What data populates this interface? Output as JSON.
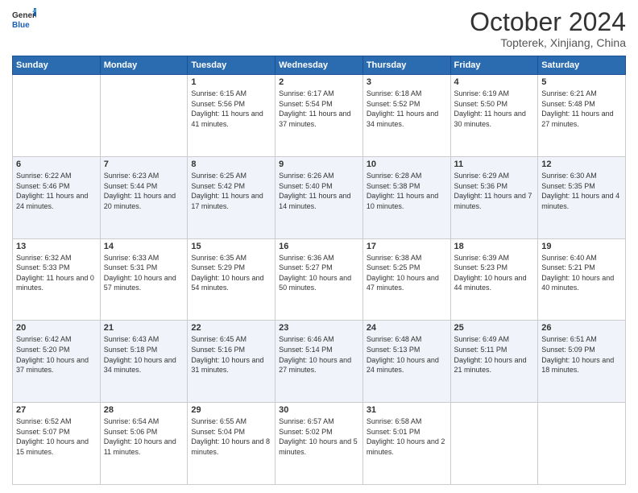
{
  "header": {
    "logo_line1": "General",
    "logo_line2": "Blue",
    "month_title": "October 2024",
    "location": "Topterek, Xinjiang, China"
  },
  "weekdays": [
    "Sunday",
    "Monday",
    "Tuesday",
    "Wednesday",
    "Thursday",
    "Friday",
    "Saturday"
  ],
  "weeks": [
    [
      {
        "day": "",
        "sunrise": "",
        "sunset": "",
        "daylight": ""
      },
      {
        "day": "",
        "sunrise": "",
        "sunset": "",
        "daylight": ""
      },
      {
        "day": "1",
        "sunrise": "Sunrise: 6:15 AM",
        "sunset": "Sunset: 5:56 PM",
        "daylight": "Daylight: 11 hours and 41 minutes."
      },
      {
        "day": "2",
        "sunrise": "Sunrise: 6:17 AM",
        "sunset": "Sunset: 5:54 PM",
        "daylight": "Daylight: 11 hours and 37 minutes."
      },
      {
        "day": "3",
        "sunrise": "Sunrise: 6:18 AM",
        "sunset": "Sunset: 5:52 PM",
        "daylight": "Daylight: 11 hours and 34 minutes."
      },
      {
        "day": "4",
        "sunrise": "Sunrise: 6:19 AM",
        "sunset": "Sunset: 5:50 PM",
        "daylight": "Daylight: 11 hours and 30 minutes."
      },
      {
        "day": "5",
        "sunrise": "Sunrise: 6:21 AM",
        "sunset": "Sunset: 5:48 PM",
        "daylight": "Daylight: 11 hours and 27 minutes."
      }
    ],
    [
      {
        "day": "6",
        "sunrise": "Sunrise: 6:22 AM",
        "sunset": "Sunset: 5:46 PM",
        "daylight": "Daylight: 11 hours and 24 minutes."
      },
      {
        "day": "7",
        "sunrise": "Sunrise: 6:23 AM",
        "sunset": "Sunset: 5:44 PM",
        "daylight": "Daylight: 11 hours and 20 minutes."
      },
      {
        "day": "8",
        "sunrise": "Sunrise: 6:25 AM",
        "sunset": "Sunset: 5:42 PM",
        "daylight": "Daylight: 11 hours and 17 minutes."
      },
      {
        "day": "9",
        "sunrise": "Sunrise: 6:26 AM",
        "sunset": "Sunset: 5:40 PM",
        "daylight": "Daylight: 11 hours and 14 minutes."
      },
      {
        "day": "10",
        "sunrise": "Sunrise: 6:28 AM",
        "sunset": "Sunset: 5:38 PM",
        "daylight": "Daylight: 11 hours and 10 minutes."
      },
      {
        "day": "11",
        "sunrise": "Sunrise: 6:29 AM",
        "sunset": "Sunset: 5:36 PM",
        "daylight": "Daylight: 11 hours and 7 minutes."
      },
      {
        "day": "12",
        "sunrise": "Sunrise: 6:30 AM",
        "sunset": "Sunset: 5:35 PM",
        "daylight": "Daylight: 11 hours and 4 minutes."
      }
    ],
    [
      {
        "day": "13",
        "sunrise": "Sunrise: 6:32 AM",
        "sunset": "Sunset: 5:33 PM",
        "daylight": "Daylight: 11 hours and 0 minutes."
      },
      {
        "day": "14",
        "sunrise": "Sunrise: 6:33 AM",
        "sunset": "Sunset: 5:31 PM",
        "daylight": "Daylight: 10 hours and 57 minutes."
      },
      {
        "day": "15",
        "sunrise": "Sunrise: 6:35 AM",
        "sunset": "Sunset: 5:29 PM",
        "daylight": "Daylight: 10 hours and 54 minutes."
      },
      {
        "day": "16",
        "sunrise": "Sunrise: 6:36 AM",
        "sunset": "Sunset: 5:27 PM",
        "daylight": "Daylight: 10 hours and 50 minutes."
      },
      {
        "day": "17",
        "sunrise": "Sunrise: 6:38 AM",
        "sunset": "Sunset: 5:25 PM",
        "daylight": "Daylight: 10 hours and 47 minutes."
      },
      {
        "day": "18",
        "sunrise": "Sunrise: 6:39 AM",
        "sunset": "Sunset: 5:23 PM",
        "daylight": "Daylight: 10 hours and 44 minutes."
      },
      {
        "day": "19",
        "sunrise": "Sunrise: 6:40 AM",
        "sunset": "Sunset: 5:21 PM",
        "daylight": "Daylight: 10 hours and 40 minutes."
      }
    ],
    [
      {
        "day": "20",
        "sunrise": "Sunrise: 6:42 AM",
        "sunset": "Sunset: 5:20 PM",
        "daylight": "Daylight: 10 hours and 37 minutes."
      },
      {
        "day": "21",
        "sunrise": "Sunrise: 6:43 AM",
        "sunset": "Sunset: 5:18 PM",
        "daylight": "Daylight: 10 hours and 34 minutes."
      },
      {
        "day": "22",
        "sunrise": "Sunrise: 6:45 AM",
        "sunset": "Sunset: 5:16 PM",
        "daylight": "Daylight: 10 hours and 31 minutes."
      },
      {
        "day": "23",
        "sunrise": "Sunrise: 6:46 AM",
        "sunset": "Sunset: 5:14 PM",
        "daylight": "Daylight: 10 hours and 27 minutes."
      },
      {
        "day": "24",
        "sunrise": "Sunrise: 6:48 AM",
        "sunset": "Sunset: 5:13 PM",
        "daylight": "Daylight: 10 hours and 24 minutes."
      },
      {
        "day": "25",
        "sunrise": "Sunrise: 6:49 AM",
        "sunset": "Sunset: 5:11 PM",
        "daylight": "Daylight: 10 hours and 21 minutes."
      },
      {
        "day": "26",
        "sunrise": "Sunrise: 6:51 AM",
        "sunset": "Sunset: 5:09 PM",
        "daylight": "Daylight: 10 hours and 18 minutes."
      }
    ],
    [
      {
        "day": "27",
        "sunrise": "Sunrise: 6:52 AM",
        "sunset": "Sunset: 5:07 PM",
        "daylight": "Daylight: 10 hours and 15 minutes."
      },
      {
        "day": "28",
        "sunrise": "Sunrise: 6:54 AM",
        "sunset": "Sunset: 5:06 PM",
        "daylight": "Daylight: 10 hours and 11 minutes."
      },
      {
        "day": "29",
        "sunrise": "Sunrise: 6:55 AM",
        "sunset": "Sunset: 5:04 PM",
        "daylight": "Daylight: 10 hours and 8 minutes."
      },
      {
        "day": "30",
        "sunrise": "Sunrise: 6:57 AM",
        "sunset": "Sunset: 5:02 PM",
        "daylight": "Daylight: 10 hours and 5 minutes."
      },
      {
        "day": "31",
        "sunrise": "Sunrise: 6:58 AM",
        "sunset": "Sunset: 5:01 PM",
        "daylight": "Daylight: 10 hours and 2 minutes."
      },
      {
        "day": "",
        "sunrise": "",
        "sunset": "",
        "daylight": ""
      },
      {
        "day": "",
        "sunrise": "",
        "sunset": "",
        "daylight": ""
      }
    ]
  ]
}
